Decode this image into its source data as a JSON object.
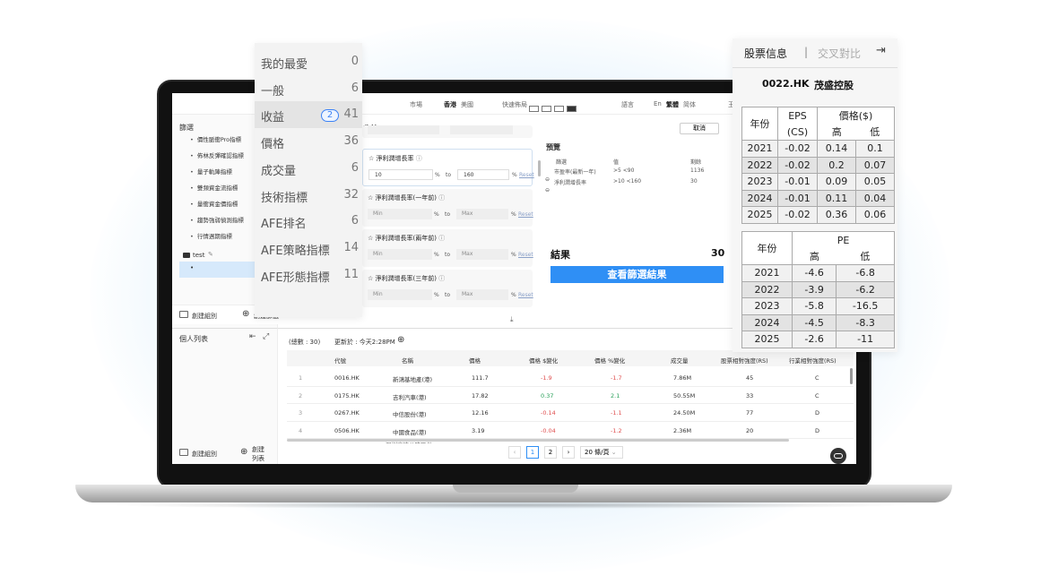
{
  "topbar": {
    "market_label": "市場",
    "market_hk": "香港",
    "market_us": "美國",
    "layout_label": "快速佈局",
    "language_label": "語言",
    "lang_en": "En",
    "lang_tc": "繁體",
    "lang_sc": "简体",
    "extra": "王"
  },
  "sidebar": {
    "title": "篩選",
    "items": [
      "價性脈衝Pro指標",
      "佈林反彈確認指標",
      "量子軌陣指標",
      "雙頻資金流指標",
      "量衝資金價指標",
      "趨勢強弱偵測指標",
      "行情週期指標"
    ],
    "folder": "test",
    "new_group": "創建組別",
    "new_filter": "創建篩選"
  },
  "watchlist": {
    "title": "個人列表",
    "new_group": "創建組別",
    "new_list": "創建列表"
  },
  "filter": {
    "section_title": "收益",
    "min_ph": "Min",
    "max_ph": "Max",
    "pct": "%",
    "to": "to",
    "reset": "Reset",
    "cancel": "取消",
    "cards": [
      {
        "title": "淨利潤增長率",
        "min": "10",
        "max": "160"
      },
      {
        "title": "淨利潤增長率(一年前)",
        "min": "",
        "max": ""
      },
      {
        "title": "淨利潤增長率(兩年前)",
        "min": "",
        "max": ""
      },
      {
        "title": "淨利潤增長率(三年前)",
        "min": "",
        "max": ""
      }
    ]
  },
  "preview": {
    "title": "預覽",
    "col_filter": "篩選",
    "col_value": "值",
    "col_remaining": "剩餘",
    "rows": [
      {
        "name": "市盈率(最新一年)",
        "value": ">5 <90",
        "remaining": "1136"
      },
      {
        "name": "淨利潤增長率",
        "value": ">10 <160",
        "remaining": "30"
      }
    ],
    "result_label": "結果",
    "result_count": "30",
    "view_button": "查看篩選結果"
  },
  "categories": [
    {
      "label": "我的最愛",
      "count": "0"
    },
    {
      "label": "一般",
      "count": "6"
    },
    {
      "label": "收益",
      "count": "41",
      "badge": "2"
    },
    {
      "label": "價格",
      "count": "36"
    },
    {
      "label": "成交量",
      "count": "6"
    },
    {
      "label": "技術指標",
      "count": "32"
    },
    {
      "label": "AFE排名",
      "count": "6"
    },
    {
      "label": "AFE策略指標",
      "count": "14"
    },
    {
      "label": "AFE形態指標",
      "count": "11"
    }
  ],
  "results": {
    "total": "(總數 : 30)",
    "updated": "更新於 : 今天2:28PM",
    "columns": [
      "代號",
      "名稱",
      "價格",
      "價格 $變化",
      "價格 %變化",
      "成交量",
      "股票相對強度(RS)",
      "行業相對強度(RS)"
    ],
    "rows": [
      {
        "no": "1",
        "code": "0016.HK",
        "name": "新鴻基地產(港)",
        "price": "111.7",
        "chg": "-1.9",
        "pct": "-1.7",
        "vol": "7.86M",
        "rs": "45",
        "irs": "C",
        "dir": "neg"
      },
      {
        "no": "2",
        "code": "0175.HK",
        "name": "吉利汽車(港)",
        "price": "17.82",
        "chg": "0.37",
        "pct": "2.1",
        "vol": "50.55M",
        "rs": "33",
        "irs": "C",
        "dir": "pos"
      },
      {
        "no": "3",
        "code": "0267.HK",
        "name": "中信股份(港)",
        "price": "12.16",
        "chg": "-0.14",
        "pct": "-1.1",
        "vol": "24.50M",
        "rs": "77",
        "irs": "D",
        "dir": "neg"
      },
      {
        "no": "4",
        "code": "0506.HK",
        "name": "中國食品(港)",
        "price": "3.19",
        "chg": "-0.04",
        "pct": "-1.2",
        "vol": "2.36M",
        "rs": "20",
        "irs": "D",
        "dir": "neg"
      }
    ],
    "partial_row": "深圳高速公路股份",
    "pages": [
      "1",
      "2"
    ],
    "page_size": "20 條/頁"
  },
  "stock_info": {
    "tab_info": "股票信息",
    "sep": "|",
    "tab_compare": "交叉對比",
    "code": "0022.HK",
    "name": "茂盛控股",
    "eps_table": {
      "h_year": "年份",
      "h_eps": "EPS",
      "h_cs": "(CS)",
      "h_price": "價格($)",
      "h_high": "高",
      "h_low": "低",
      "rows": [
        {
          "year": "2021",
          "eps": "-0.02",
          "high": "0.14",
          "low": "0.1"
        },
        {
          "year": "2022",
          "eps": "-0.02",
          "high": "0.2",
          "low": "0.07"
        },
        {
          "year": "2023",
          "eps": "-0.01",
          "high": "0.09",
          "low": "0.05"
        },
        {
          "year": "2024",
          "eps": "-0.01",
          "high": "0.11",
          "low": "0.04"
        },
        {
          "year": "2025",
          "eps": "-0.02",
          "high": "0.36",
          "low": "0.06"
        }
      ]
    },
    "pe_table": {
      "h_year": "年份",
      "h_pe": "PE",
      "h_high": "高",
      "h_low": "低",
      "rows": [
        {
          "year": "2021",
          "high": "-4.6",
          "low": "-6.8"
        },
        {
          "year": "2022",
          "high": "-3.9",
          "low": "-6.2"
        },
        {
          "year": "2023",
          "high": "-5.8",
          "low": "-16.5"
        },
        {
          "year": "2024",
          "high": "-4.5",
          "low": "-8.3"
        },
        {
          "year": "2025",
          "high": "-2.6",
          "low": "-11"
        }
      ]
    }
  }
}
